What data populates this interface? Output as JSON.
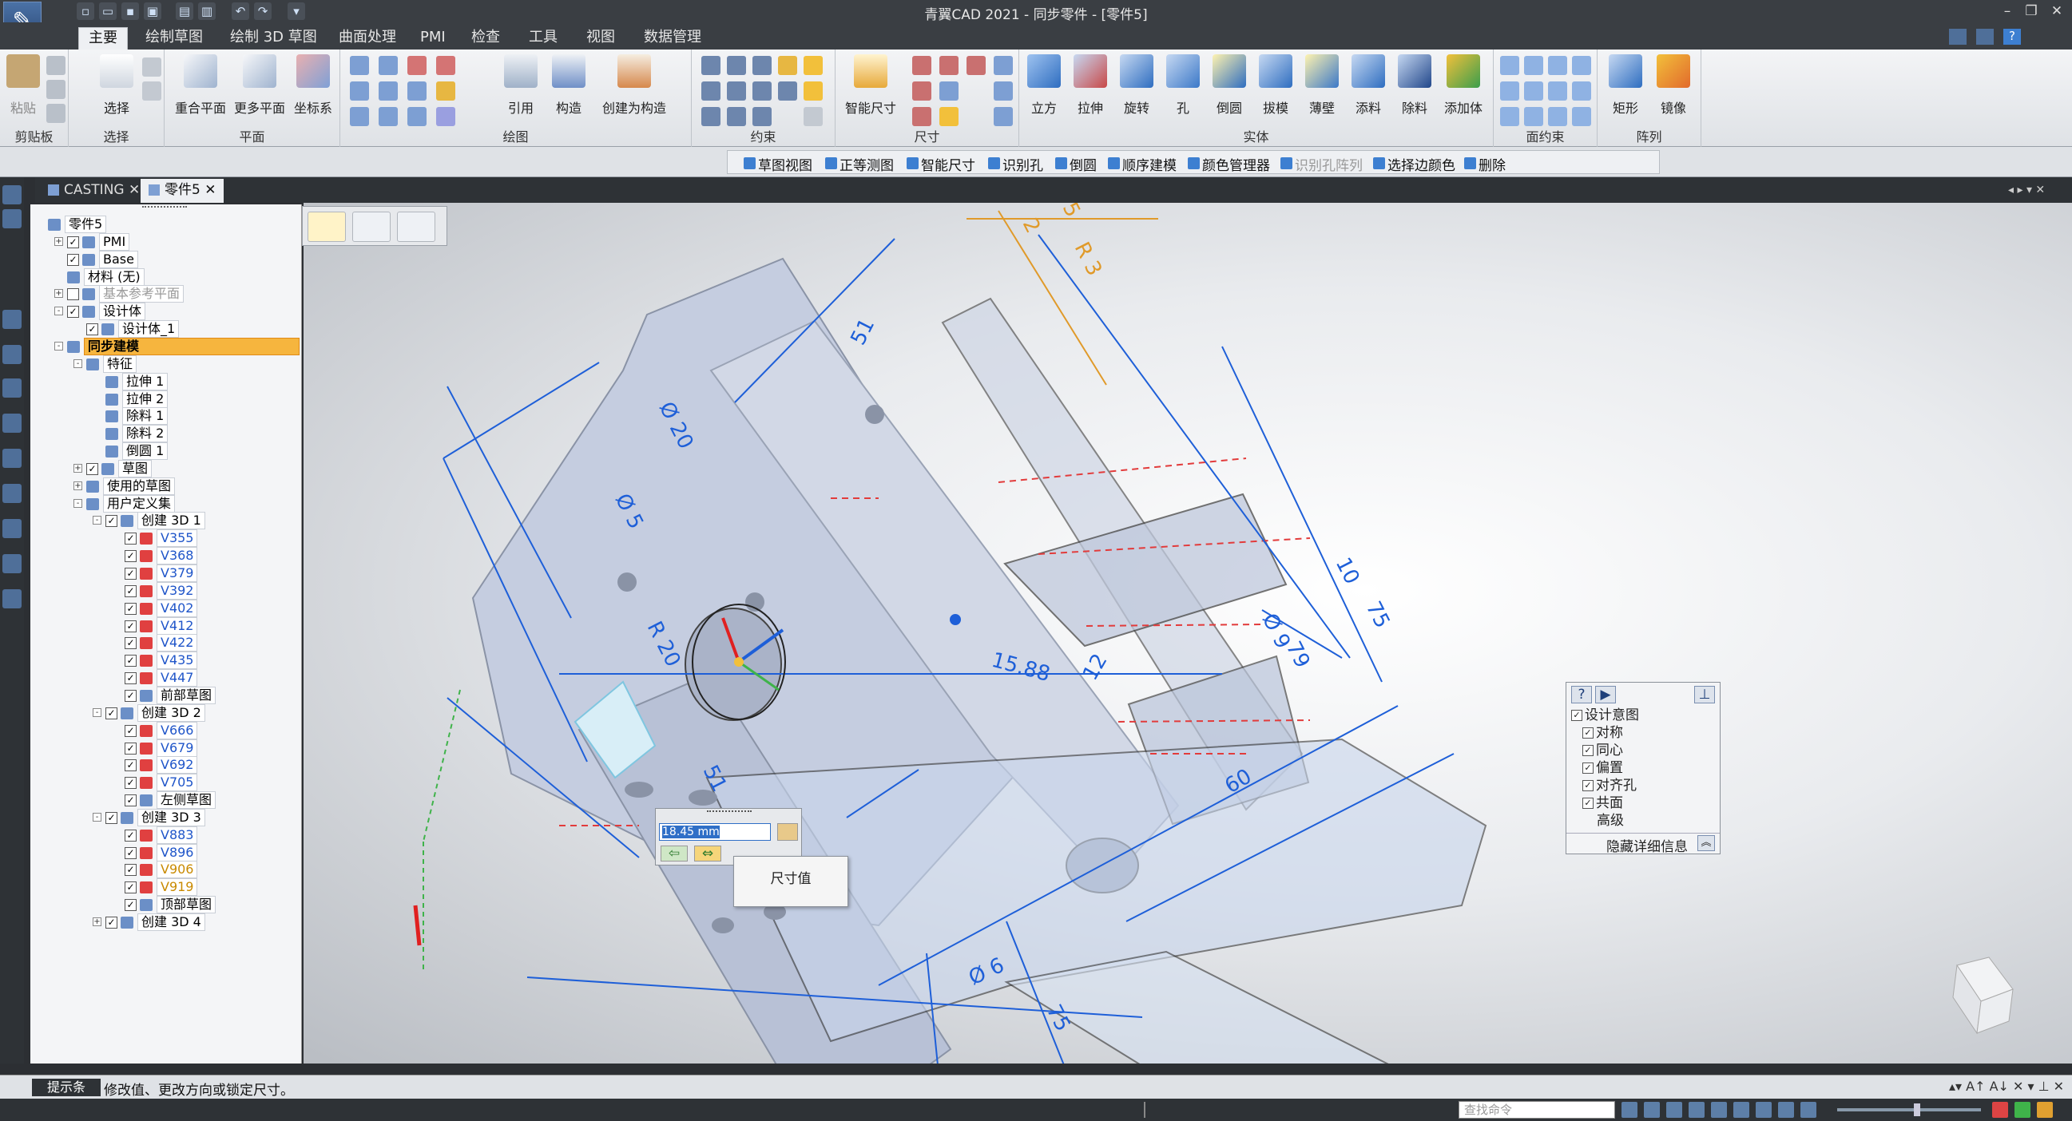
{
  "app": {
    "title": "青翼CAD 2021 - 同步零件 - [零件5]"
  },
  "colors": {
    "accent": "#3d7fd1",
    "highlight": "#f6b53e",
    "dim_blue": "#1e5fd8",
    "part_fill": "#c9d1e0",
    "hidden_red": "#e23b3b",
    "orange_dim": "#e09a2a"
  },
  "ribbon_tabs": [
    "主要",
    "绘制草图",
    "绘制 3D 草图",
    "曲面处理",
    "PMI",
    "检查",
    "工具",
    "视图",
    "数据管理"
  ],
  "ribbon": {
    "clipboard": {
      "paste": "粘贴",
      "label": "剪贴板"
    },
    "select": {
      "button": "选择",
      "label": "选择"
    },
    "plane": {
      "coincident": "重合平面",
      "more": "更多平面",
      "coord": "坐标系",
      "label": "平面"
    },
    "draw": {
      "label": "绘图",
      "reference": "引用",
      "construct": "构造",
      "make_construct": "创建为构造"
    },
    "constraint": {
      "label": "约束"
    },
    "dimension": {
      "smart": "智能尺寸",
      "label": "尺寸"
    },
    "solid": {
      "label": "实体",
      "buttons": [
        "立方",
        "拉伸",
        "旋转",
        "孔",
        "倒圆",
        "拔模",
        "薄壁",
        "添料",
        "除料",
        "添加体"
      ]
    },
    "face_constraint": {
      "label": "面约束"
    },
    "pattern": {
      "label": "阵列",
      "rect": "矩形",
      "mirror": "镜像"
    }
  },
  "command_bar": [
    "草图视图",
    "正等测图",
    "智能尺寸",
    "识别孔",
    "倒圆",
    "顺序建模",
    "颜色管理器",
    "识别孔阵列",
    "选择边颜色",
    "删除"
  ],
  "doc_tabs": [
    {
      "label": "CASTING",
      "close": "✕"
    },
    {
      "label": "零件5",
      "close": "✕"
    }
  ],
  "tree": [
    {
      "text": "零件5"
    },
    {
      "text": "PMI"
    },
    {
      "text": "Base"
    },
    {
      "text": "材料 (无)"
    },
    {
      "text": "基本参考平面"
    },
    {
      "text": "设计体"
    },
    {
      "text": "设计体_1"
    },
    {
      "text": "同步建模"
    },
    {
      "text": "特征"
    },
    {
      "text": "拉伸 1"
    },
    {
      "text": "拉伸 2"
    },
    {
      "text": "除料 1"
    },
    {
      "text": "除料 2"
    },
    {
      "text": "倒圆 1"
    },
    {
      "text": "草图"
    },
    {
      "text": "使用的草图"
    },
    {
      "text": "用户定义集"
    },
    {
      "text": "创建 3D 1"
    },
    {
      "text": "V355"
    },
    {
      "text": "V368"
    },
    {
      "text": "V379"
    },
    {
      "text": "V392"
    },
    {
      "text": "V402"
    },
    {
      "text": "V412"
    },
    {
      "text": "V422"
    },
    {
      "text": "V435"
    },
    {
      "text": "V447"
    },
    {
      "text": "前部草图"
    },
    {
      "text": "创建 3D 2"
    },
    {
      "text": "V666"
    },
    {
      "text": "V679"
    },
    {
      "text": "V692"
    },
    {
      "text": "V705"
    },
    {
      "text": "左侧草图"
    },
    {
      "text": "创建 3D 3"
    },
    {
      "text": "V883"
    },
    {
      "text": "V896"
    },
    {
      "text": "V906"
    },
    {
      "text": "V919"
    },
    {
      "text": "顶部草图"
    },
    {
      "text": "创建 3D 4"
    }
  ],
  "dims": [
    "51",
    "Ø 20",
    "Ø 5",
    "R 20",
    "51",
    "15.88",
    "Ø 6",
    "75",
    "60",
    "10",
    "Ø 9",
    "79",
    "12",
    "75",
    "R 3",
    "2",
    "5"
  ],
  "dim_edit": {
    "value": "18.45 mm"
  },
  "tooltip": "尺寸值",
  "intent_panel": {
    "title": "设计意图",
    "items": [
      "对称",
      "同心",
      "偏置",
      "对齐孔",
      "共面"
    ],
    "advanced": "高级",
    "hide": "隐藏详细信息"
  },
  "status": {
    "label": "提示条",
    "text": "修改值、更改方向或锁定尺寸。"
  },
  "search_placeholder": "查找命令"
}
